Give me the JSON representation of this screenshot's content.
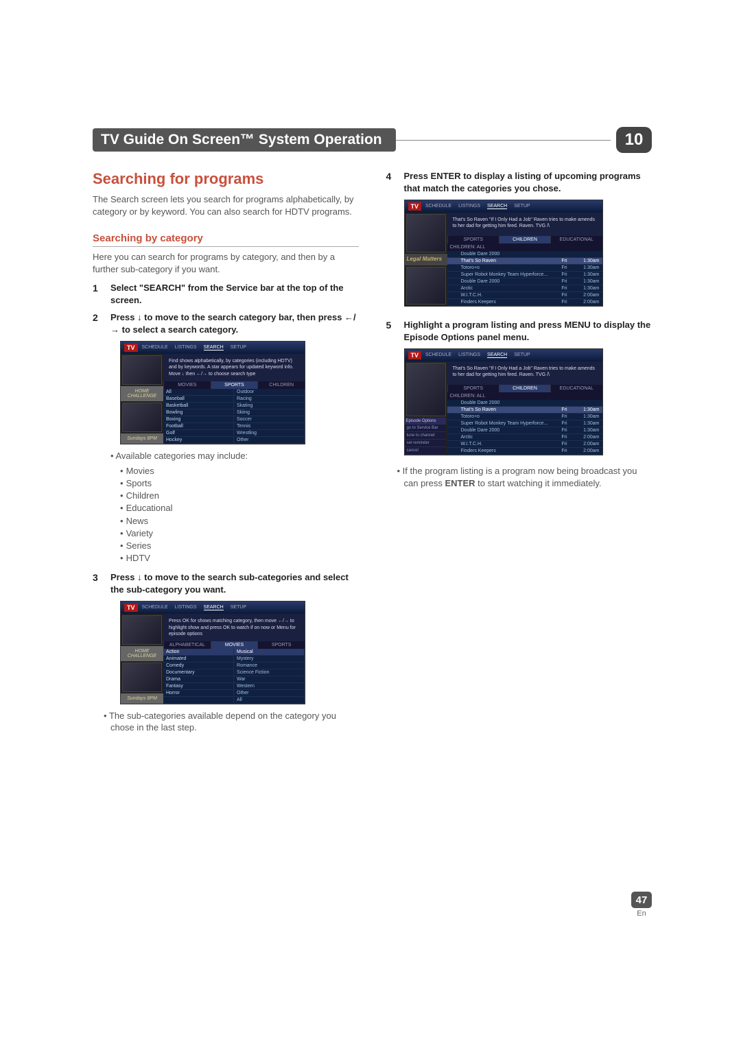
{
  "chapter": {
    "title": "TV Guide On Screen™ System Operation",
    "number": "10"
  },
  "section_title": "Searching for programs",
  "intro": "The Search screen lets you search for programs alphabetically, by category or by keyword. You can also search for HDTV programs.",
  "sub_heading": "Searching by category",
  "sub_intro": "Here you can search for programs by category, and then by a further sub-category if you want.",
  "left_steps": {
    "s1": "Select \"SEARCH\" from the Service bar at the top of the screen.",
    "s2_a": "Press ",
    "s2_b": " to move to the search category bar, then press ",
    "s2_c": " to select a search category.",
    "s3_a": "Press ",
    "s3_b": " to move to the search sub-categories and select the sub-category you want."
  },
  "arrows": {
    "down": "↓",
    "leftright": "←/→"
  },
  "categories_lead": "Available categories may include:",
  "categories": [
    "Movies",
    "Sports",
    "Children",
    "Educational",
    "News",
    "Variety",
    "Series",
    "HDTV"
  ],
  "subcat_note": "The sub-categories available depend on the category you chose in the last step.",
  "right_steps": {
    "s4": "Press ENTER to display a listing of upcoming programs that match the categories you chose.",
    "s5": "Highlight a program listing and press MENU to display the Episode Options panel menu."
  },
  "right_note_a": "If the program listing is a program now being broadcast you can press ",
  "right_note_b": "ENTER",
  "right_note_c": " to start watching it immediately.",
  "page_number": "47",
  "page_lang": "En",
  "ss_common": {
    "logo": "TV",
    "tabs": [
      "SCHEDULE",
      "LISTINGS",
      "SEARCH",
      "SETUP"
    ],
    "promo_home": "HOME CHALLENGE",
    "promo_sun": "Sundays 8PM",
    "promo_legal": "Legal Matters"
  },
  "ss1": {
    "info": "Find shows alphabetically, by categories (including HDTV) and by keywords. A star appears for updated keyword info. Move ↓ then ←/→ to choose search type",
    "catbar": [
      "MOVIES",
      "SPORTS",
      "CHILDREN"
    ],
    "rows": [
      [
        "All",
        "Outdoor"
      ],
      [
        "Baseball",
        "Racing"
      ],
      [
        "Basketball",
        "Skating"
      ],
      [
        "Bowling",
        "Skiing"
      ],
      [
        "Boxing",
        "Soccer"
      ],
      [
        "Football",
        "Tennis"
      ],
      [
        "Golf",
        "Wrestling"
      ],
      [
        "Hockey",
        "Other"
      ]
    ]
  },
  "ss2": {
    "info": "Press OK for shows matching category, then move ←/→ to highlight show and press OK to watch if on now or Menu for episode options",
    "catbar": [
      "ALPHABETICAL",
      "MOVIES",
      "SPORTS"
    ],
    "rows": [
      [
        "Action",
        "Musical"
      ],
      [
        "Animated",
        "Mystery"
      ],
      [
        "Comedy",
        "Romance"
      ],
      [
        "Documentary",
        "Science Fiction"
      ],
      [
        "Drama",
        "War"
      ],
      [
        "Fantasy",
        "Western"
      ],
      [
        "Horror",
        "Other"
      ],
      [
        "",
        "All"
      ]
    ]
  },
  "ss3": {
    "info": "That's So Raven \"If I Only Had a Job\"  Raven tries to make amends to her dad for getting him fired. Raven. TVG /\\",
    "catbar": [
      "SPORTS",
      "CHILDREN",
      "EDUCATIONAL"
    ],
    "header": "CHILDREN: ALL",
    "list": [
      {
        "ch": "",
        "name": "Double Dare 2000",
        "day": "",
        "time": ""
      },
      {
        "ch": "",
        "name": "That's So Raven",
        "day": "Fri",
        "time": "1:30am",
        "hi": true
      },
      {
        "ch": "",
        "name": "Totoro+o",
        "day": "Fri",
        "time": "1:30am"
      },
      {
        "ch": "",
        "name": "Super Robot Monkey Team Hyperforce...",
        "day": "Fri",
        "time": "1:30am"
      },
      {
        "ch": "",
        "name": "Double Dare 2000",
        "day": "Fri",
        "time": "1:30am"
      },
      {
        "ch": "",
        "name": "Arctic",
        "day": "Fri",
        "time": "1:30am"
      },
      {
        "ch": "",
        "name": "W.I.T.C.H.",
        "day": "Fri",
        "time": "2:00am"
      },
      {
        "ch": "",
        "name": "Finders Keepers",
        "day": "Fri",
        "time": "2:00am"
      }
    ]
  },
  "ss4": {
    "info": "That's So Raven \"If I Only Had a Job\"  Raven tries to make amends to her dad for getting him fired. Raven. TVG /\\",
    "epops_title": "Episode Options",
    "epops": [
      "go to Service Bar",
      "tune to channel",
      "set reminder",
      "cancel"
    ],
    "catbar": [
      "SPORTS",
      "CHILDREN",
      "EDUCATIONAL"
    ],
    "header": "CHILDREN: ALL",
    "list": [
      {
        "ch": "",
        "name": "Double Dare 2000",
        "day": "",
        "time": ""
      },
      {
        "ch": "",
        "name": "That's So Raven",
        "day": "Fri",
        "time": "1:30am",
        "hi": true
      },
      {
        "ch": "",
        "name": "Totoro+o",
        "day": "Fri",
        "time": "1:30am"
      },
      {
        "ch": "",
        "name": "Super Robot Monkey Team Hyperforce...",
        "day": "Fri",
        "time": "1:30am"
      },
      {
        "ch": "",
        "name": "Double Dare 2000",
        "day": "Fri",
        "time": "1:30am"
      },
      {
        "ch": "",
        "name": "Arctic",
        "day": "Fri",
        "time": "2:00am"
      },
      {
        "ch": "",
        "name": "W.I.T.C.H.",
        "day": "Fri",
        "time": "2:00am"
      },
      {
        "ch": "",
        "name": "Finders Keepers",
        "day": "Fri",
        "time": "2:00am"
      }
    ]
  }
}
